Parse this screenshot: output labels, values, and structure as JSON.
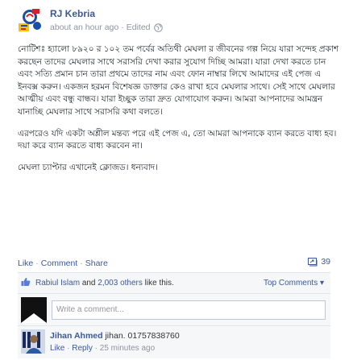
{
  "post": {
    "page_name": "RJ Kebria",
    "timestamp": "about an hour ago",
    "separator": "·",
    "edited": "Edited",
    "paragraphs": [
      "নোটিশঃ হ্যালো ৮৯২০ র ১০২ তম পর্বের অতিথী মেঘলা র জীবনের গল্প নিয়ে যারা সন্দেহ প্রকাশ করছেন তাদের মেঘলার সাথে সরাসরি দেখা করার সুযোগ দিচ্ছি আমরা। যারা দেখা করতে চান এবং সত্যি প্রমান চান তারা প্রথমে তাদের নাম এবং ফোন নাম্বার লিখে আমাদের এই পেজ এ ইনবক্স করুন। একজন হরমন বিশেষজ্ঞ ডাক্তার কেও রাখা হবে মেঘলার সাথে। সেই সাথে মেঘলার আত্মীয় এবং বন্ধু বান্ধব। যারা ইচ্ছুক তারা দ্রুত যোগাযোগ করুন। আমরা আপনাদের আমন্ত্রন যানাচ্ছি মেঘলার সাথে সরাসরি কথা বলতে।",
      "এরপরেও যদি একটা অশ্লীল মন্তব্য পরে এই পেজ এ, তো আমরা আপনাকে ব্যান করতে বাধ্য হব। দয়া করে ব্যান করতে বাধ্য করবেন না।",
      "মেঘলা চ্যাপ্টার এখানেই ক্লোজড। ধন্যবাদ।"
    ]
  },
  "actions": {
    "like": "Like",
    "comment": "Comment",
    "share": "Share",
    "dot": "·",
    "share_count": "39"
  },
  "likes": {
    "first_name": "Rabiul Islam",
    "and": "and",
    "others": "2,003 others",
    "suffix": "like this.",
    "top_comments": "Top Comments ▾"
  },
  "composer": {
    "placeholder": "Write a comment..."
  },
  "comment": {
    "author": "Jihan Ahmed",
    "text": "jihan. 01757838760",
    "like": "Like",
    "reply": "Reply",
    "dot": "·",
    "time": "25 minutes ago"
  },
  "colors": {
    "link": "#3b5998",
    "muted": "#90949c",
    "text": "#1d2129"
  }
}
